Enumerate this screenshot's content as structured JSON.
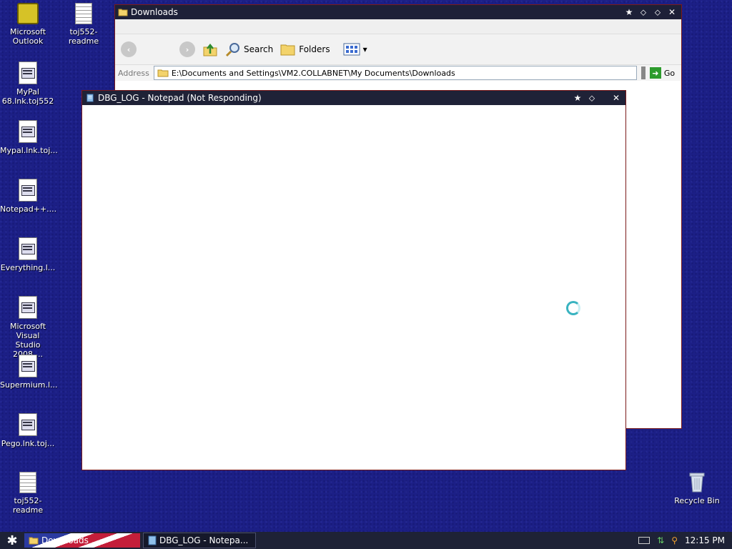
{
  "desktop": {
    "icons": [
      {
        "label": "Microsoft\nOutlook"
      },
      {
        "label": "toj552-readme"
      },
      {
        "label": "MyPal\n68.lnk.toj552"
      },
      {
        "label": "Mypal.lnk.toj..."
      },
      {
        "label": "Notepad++...."
      },
      {
        "label": "Everything.l..."
      },
      {
        "label": "Microsoft Visual\nStudio 2008...."
      },
      {
        "label": "Supermium.l..."
      },
      {
        "label": "Pego.lnk.toj..."
      },
      {
        "label": "toj552-readme"
      },
      {
        "label": "Recycle Bin"
      }
    ]
  },
  "explorer": {
    "title": "Downloads",
    "toolbar": {
      "search_label": "Search",
      "folders_label": "Folders"
    },
    "address": {
      "label": "Address",
      "path": "E:\\Documents and Settings\\VM2.COLLABNET\\My Documents\\Downloads",
      "go_label": "Go"
    }
  },
  "notepad": {
    "title": "DBG_LOG - Notepad (Not Responding)"
  },
  "taskbar": {
    "tasks": [
      {
        "label": "Downloads"
      },
      {
        "label": "DBG_LOG - Notepa..."
      }
    ],
    "clock": "12:15 PM"
  }
}
